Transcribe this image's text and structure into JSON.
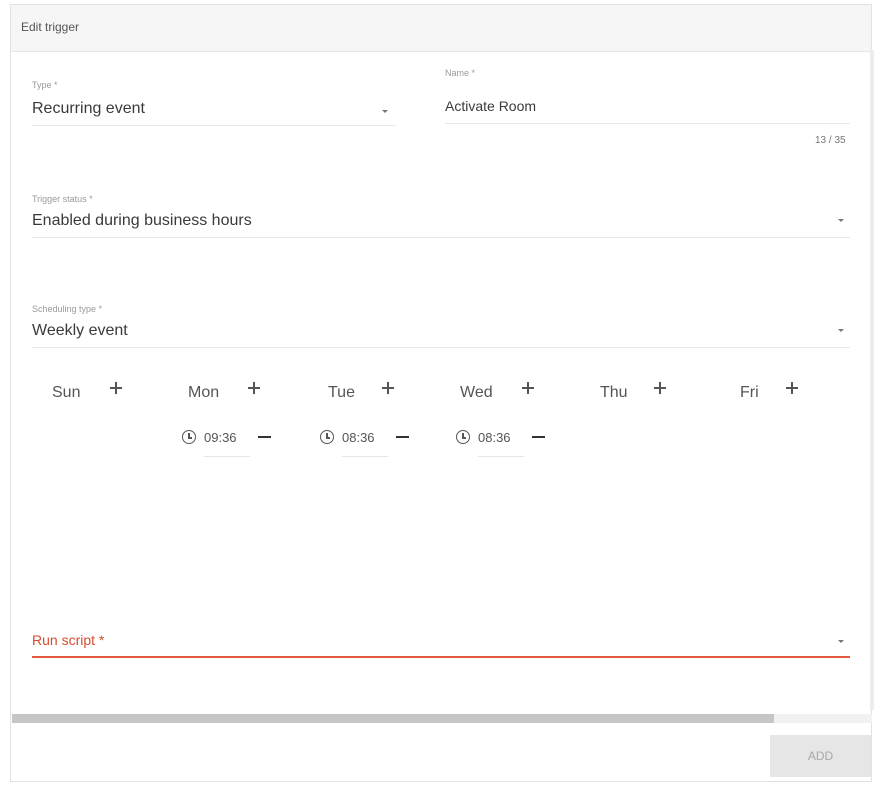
{
  "dialog": {
    "title": "Edit trigger"
  },
  "type_field": {
    "label": "Type *",
    "value": "Recurring event"
  },
  "name_field": {
    "label": "Name *",
    "value": "Activate Room",
    "counter": "13 / 35"
  },
  "trigger_status_field": {
    "label": "Trigger status *",
    "value": "Enabled during business hours"
  },
  "scheduling_type_field": {
    "label": "Scheduling type *",
    "value": "Weekly event"
  },
  "days": [
    "Sun",
    "Mon",
    "Tue",
    "Wed",
    "Thu",
    "Fri"
  ],
  "times": {
    "mon": "09:36",
    "tue": "08:36",
    "wed": "08:36"
  },
  "run_script_field": {
    "label": "Run script *"
  },
  "footer": {
    "add_label": "ADD"
  },
  "colors": {
    "error": "#e25a3f",
    "label": "#9a9a9a"
  }
}
